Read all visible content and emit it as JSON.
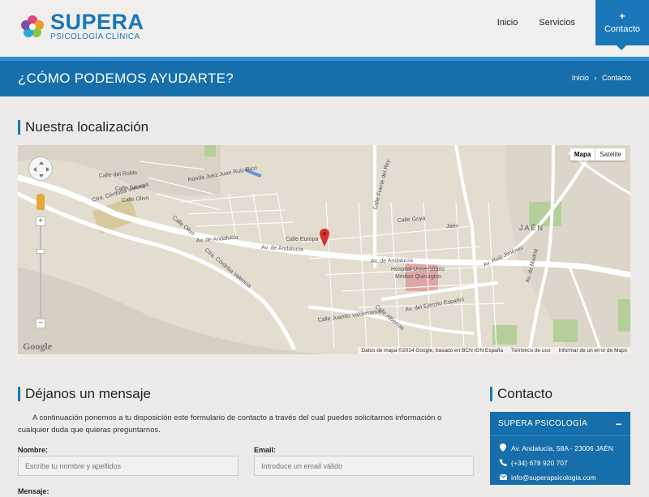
{
  "brand": {
    "name": "SUPERA",
    "tagline": "PSICOLOGÍA CLÍNICA"
  },
  "nav": {
    "items": [
      "Inicio",
      "Servicios"
    ],
    "active": "Contacto",
    "active_icon": "+"
  },
  "banner": {
    "title": "¿CÓMO PODEMOS AYUDARTE?",
    "crumb_home": "Inicio",
    "crumb_sep": "›",
    "crumb_current": "Contacto"
  },
  "location": {
    "heading": "Nuestra localización"
  },
  "map": {
    "type_map": "Mapa",
    "type_satellite": "Satélite",
    "google": "Google",
    "footer": [
      "Datos de mapa ©2014 Google, basado en BCN IGN España",
      "Términos de uso",
      "Informar de un error de Maps"
    ],
    "labels": [
      "Av. de Andalucía",
      "Av. de Andalucía",
      "Av. de Andalucía",
      "Ctra. Córdoba Valencia",
      "Ctra. Córdoba Valencia",
      "Calle del Roble",
      "Calle Sauce",
      "Calle Olivo",
      "Calle Olivo",
      "Ronda Juez Juan Ruiz Rico",
      "Calle Fuerte del Rey",
      "Calle Goya",
      "Calle Europa",
      "Hospital Universitario",
      "Médico Quirúrgico",
      "Calle Juanito Valderrama",
      "Av. del Ejército Español",
      "Av. Ruiz Jiménez",
      "Av. de Madrid",
      "JAÉN",
      "Calle Albercas",
      "Jaén"
    ],
    "colors": {
      "land": "#e3ddd0",
      "road": "#ffffff",
      "park": "#b5cf9a",
      "hill": "#d4cebf",
      "water": "#6e8fd1",
      "marker": "#d8312b"
    }
  },
  "message": {
    "heading": "Déjanos un mensaje",
    "intro": "A continuación ponemos a tu disposición este formulario de contacto a través del cual puedes solicitarnos información o cualquier duda que quieras preguntarnos.",
    "name_label": "Nombre:",
    "name_placeholder": "Escribe tu nombre y apellidos",
    "email_label": "Email:",
    "email_placeholder": "Introduce un email válido",
    "message_label": "Mensaje:"
  },
  "contact": {
    "heading": "Contacto",
    "card_title": "SUPERA PSICOLOGÍA",
    "address": "Av. Andalucía, 58A - 23006 JAÉN",
    "phone": "(+34) 678 920 707",
    "email": "info@superapsicologia.com"
  },
  "colors": {
    "brand_blue": "#1a78b8",
    "banner_blue": "#166fab",
    "page_bg": "#ecebe9"
  }
}
